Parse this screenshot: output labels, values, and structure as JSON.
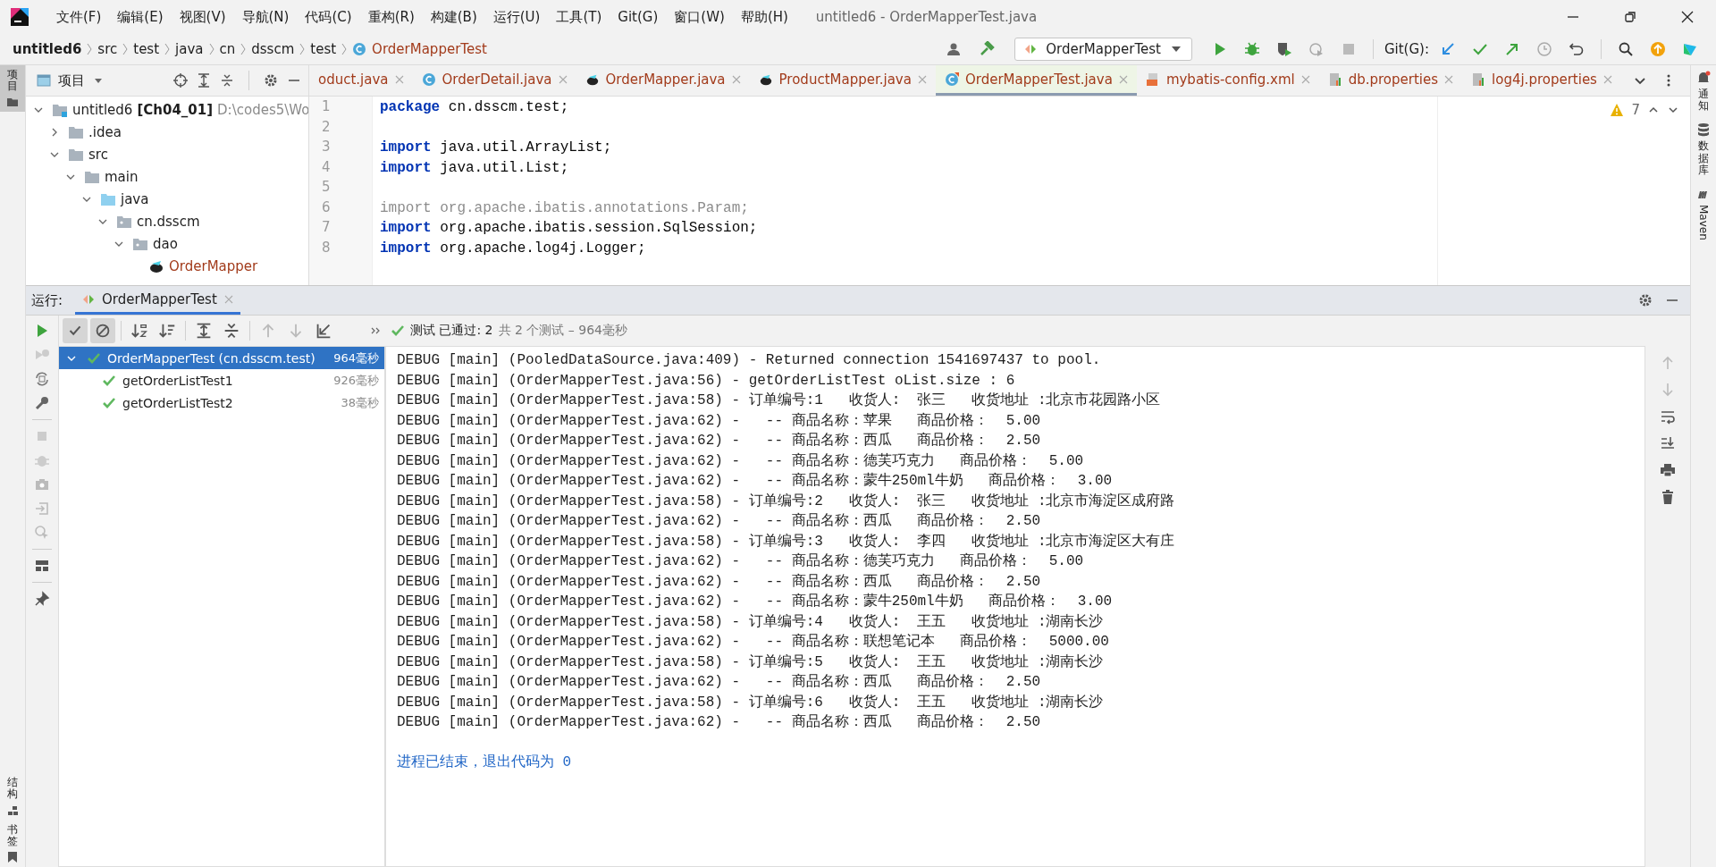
{
  "window": {
    "title": "untitled6 - OrderMapperTest.java"
  },
  "menu": [
    "文件(F)",
    "编辑(E)",
    "视图(V)",
    "导航(N)",
    "代码(C)",
    "重构(R)",
    "构建(B)",
    "运行(U)",
    "工具(T)",
    "Git(G)",
    "窗口(W)",
    "帮助(H)"
  ],
  "breadcrumb": [
    {
      "label": "untitled6",
      "kind": "project"
    },
    {
      "label": "src",
      "kind": "dir"
    },
    {
      "label": "test",
      "kind": "dir"
    },
    {
      "label": "java",
      "kind": "dir"
    },
    {
      "label": "cn",
      "kind": "dir"
    },
    {
      "label": "dsscm",
      "kind": "dir"
    },
    {
      "label": "test",
      "kind": "dir"
    },
    {
      "label": "OrderMapperTest",
      "kind": "class"
    }
  ],
  "toolbar": {
    "run_config": "OrderMapperTest",
    "git_label": "Git(G):"
  },
  "left_strip": {
    "top": [
      {
        "label": "项目",
        "selected": true
      }
    ],
    "bottom": [
      {
        "label": "结构",
        "selected": false
      },
      {
        "label": "书签",
        "selected": false
      }
    ]
  },
  "project_panel": {
    "title": "项目",
    "tree": [
      {
        "label": "untitled6",
        "module": "[Ch04_01]",
        "path": "D:\\codes5\\Wo",
        "kind": "module",
        "expanded": true,
        "children": [
          {
            "label": ".idea",
            "kind": "folder",
            "expanded": false
          },
          {
            "label": "src",
            "kind": "folder",
            "expanded": true,
            "children": [
              {
                "label": "main",
                "kind": "folder",
                "expanded": true,
                "children": [
                  {
                    "label": "java",
                    "kind": "source",
                    "expanded": true,
                    "children": [
                      {
                        "label": "cn.dsscm",
                        "kind": "package",
                        "expanded": true,
                        "children": [
                          {
                            "label": "dao",
                            "kind": "package",
                            "expanded": true,
                            "children": [
                              {
                                "label": "OrderMapper",
                                "kind": "mapper"
                              }
                            ]
                          }
                        ]
                      }
                    ]
                  }
                ]
              }
            ]
          }
        ]
      }
    ]
  },
  "editor_tabs": [
    {
      "label": "oduct.java",
      "kind": "cut",
      "selected": false
    },
    {
      "label": "OrderDetail.java",
      "kind": "class",
      "selected": false
    },
    {
      "label": "OrderMapper.java",
      "kind": "mapper",
      "selected": false
    },
    {
      "label": "ProductMapper.java",
      "kind": "mapper",
      "selected": false
    },
    {
      "label": "OrderMapperTest.java",
      "kind": "test",
      "selected": true
    },
    {
      "label": "mybatis-config.xml",
      "kind": "xml",
      "selected": false
    },
    {
      "label": "db.properties",
      "kind": "properties",
      "selected": false
    },
    {
      "label": "log4j.properties",
      "kind": "properties",
      "selected": false
    }
  ],
  "editor": {
    "warnings": "7",
    "lines": [
      {
        "number": "1",
        "text": "**package** cn.dsscm.test;"
      },
      {
        "number": "2"
      },
      {
        "number": "3",
        "text": "**import** java.util.ArrayList;"
      },
      {
        "number": "4",
        "text": "**import** java.util.List;"
      },
      {
        "number": "5"
      },
      {
        "number": "6",
        "text": "import org.apache.ibatis.annotations.Param;",
        "unused": true
      },
      {
        "number": "7",
        "text": "**import** org.apache.ibatis.session.SqlSession;"
      },
      {
        "number": "8",
        "text": "**import** org.apache.log4j.Logger;"
      }
    ]
  },
  "run_panel": {
    "label": "运行:",
    "tab": "OrderMapperTest",
    "status": {
      "label": "测试 已通过: 2",
      "detail": "共 2 个测试 – 964毫秒"
    },
    "tests": [
      {
        "label": "OrderMapperTest (cn.dsscm.test)",
        "time": "964毫秒",
        "passed": true,
        "selected": true,
        "expanded": true,
        "children": [
          {
            "label": "getOrderListTest1",
            "time": "926毫秒",
            "passed": true,
            "selected": false
          },
          {
            "label": "getOrderListTest2",
            "time": "38毫秒",
            "passed": true,
            "selected": false
          }
        ]
      }
    ],
    "console": [
      {
        "kind": "log",
        "text": "DEBUG [main] (PooledDataSource.java:409) - Returned connection 1541697437 to pool."
      },
      {
        "kind": "log",
        "text": "DEBUG [main] (OrderMapperTest.java:56) - getOrderListTest oList.size : 6"
      },
      {
        "kind": "log",
        "text": "DEBUG [main] (OrderMapperTest.java:58) - 订单编号:1   收货人:  张三   收货地址 :北京市花园路小区"
      },
      {
        "kind": "log",
        "text": "DEBUG [main] (OrderMapperTest.java:62) -   -- 商品名称：苹果   商品价格：  5.00"
      },
      {
        "kind": "log",
        "text": "DEBUG [main] (OrderMapperTest.java:62) -   -- 商品名称：西瓜   商品价格：  2.50"
      },
      {
        "kind": "log",
        "text": "DEBUG [main] (OrderMapperTest.java:62) -   -- 商品名称：德芙巧克力   商品价格：  5.00"
      },
      {
        "kind": "log",
        "text": "DEBUG [main] (OrderMapperTest.java:62) -   -- 商品名称：蒙牛250ml牛奶   商品价格：  3.00"
      },
      {
        "kind": "log",
        "text": "DEBUG [main] (OrderMapperTest.java:58) - 订单编号:2   收货人:  张三   收货地址 :北京市海淀区成府路"
      },
      {
        "kind": "log",
        "text": "DEBUG [main] (OrderMapperTest.java:62) -   -- 商品名称：西瓜   商品价格：  2.50"
      },
      {
        "kind": "log",
        "text": "DEBUG [main] (OrderMapperTest.java:58) - 订单编号:3   收货人:  李四   收货地址 :北京市海淀区大有庄"
      },
      {
        "kind": "log",
        "text": "DEBUG [main] (OrderMapperTest.java:62) -   -- 商品名称：德芙巧克力   商品价格：  5.00"
      },
      {
        "kind": "log",
        "text": "DEBUG [main] (OrderMapperTest.java:62) -   -- 商品名称：西瓜   商品价格：  2.50"
      },
      {
        "kind": "log",
        "text": "DEBUG [main] (OrderMapperTest.java:62) -   -- 商品名称：蒙牛250ml牛奶   商品价格：  3.00"
      },
      {
        "kind": "log",
        "text": "DEBUG [main] (OrderMapperTest.java:58) - 订单编号:4   收货人:  王五   收货地址 :湖南长沙"
      },
      {
        "kind": "log",
        "text": "DEBUG [main] (OrderMapperTest.java:62) -   -- 商品名称：联想笔记本   商品价格：  5000.00"
      },
      {
        "kind": "log",
        "text": "DEBUG [main] (OrderMapperTest.java:58) - 订单编号:5   收货人:  王五   收货地址 :湖南长沙"
      },
      {
        "kind": "log",
        "text": "DEBUG [main] (OrderMapperTest.java:62) -   -- 商品名称：西瓜   商品价格：  2.50"
      },
      {
        "kind": "log",
        "text": "DEBUG [main] (OrderMapperTest.java:58) - 订单编号:6   收货人:  王五   收货地址 :湖南长沙"
      },
      {
        "kind": "log",
        "text": "DEBUG [main] (OrderMapperTest.java:62) -   -- 商品名称：西瓜   商品价格：  2.50"
      },
      {
        "kind": "blank"
      },
      {
        "kind": "exit",
        "text": "进程已结束，退出代码为 0"
      }
    ]
  },
  "right_strip": [
    {
      "label": "通知",
      "kind": "bell"
    },
    {
      "label": "数据库",
      "kind": "database"
    },
    {
      "label": "Maven",
      "kind": "maven"
    }
  ]
}
